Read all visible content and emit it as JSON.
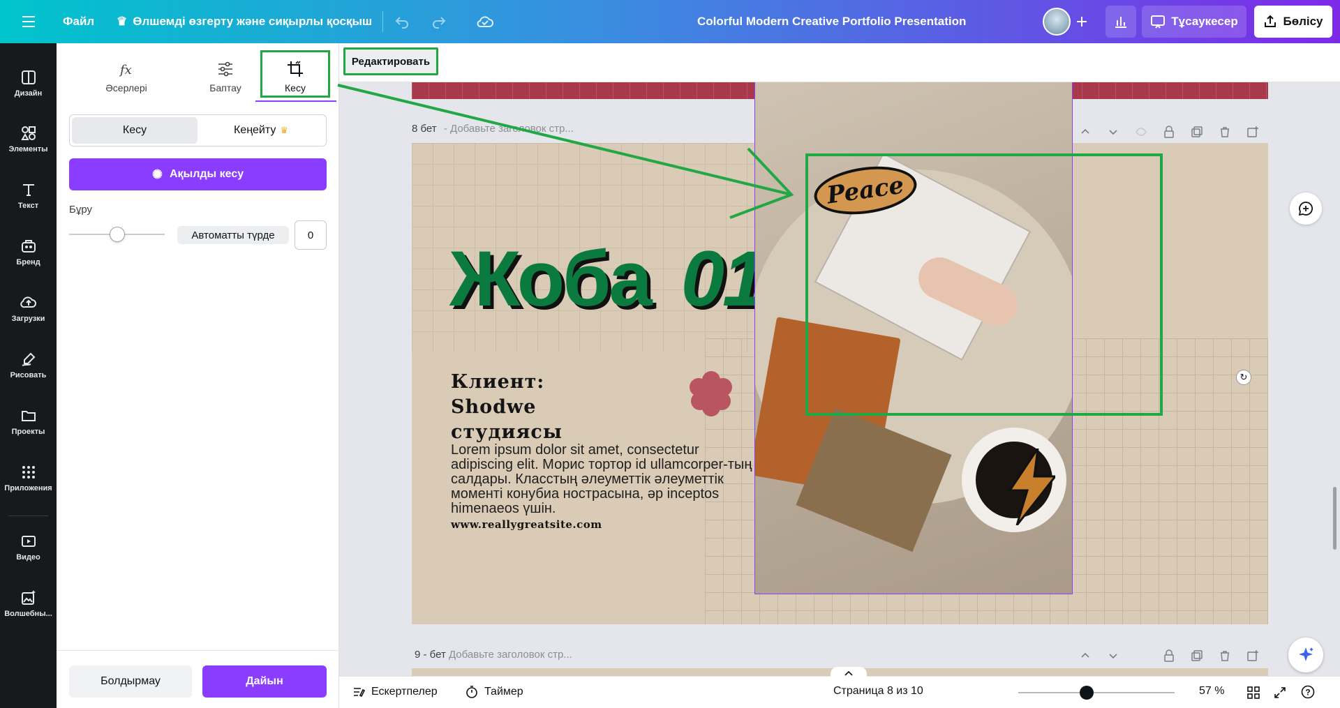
{
  "topbar": {
    "file_label": "Файл",
    "resize_label": "Өлшемді өзгерту және сиқырлы қосқыш",
    "doc_title": "Colorful Modern Creative Portfolio Presentation",
    "present_label": "Тұсаукесер",
    "share_label": "Бөлісу"
  },
  "rail": {
    "items": [
      {
        "label": "Дизайн",
        "icon": "design-icon"
      },
      {
        "label": "Элементы",
        "icon": "elements-icon"
      },
      {
        "label": "Текст",
        "icon": "text-icon"
      },
      {
        "label": "Бренд",
        "icon": "brand-icon"
      },
      {
        "label": "Загрузки",
        "icon": "upload-icon"
      },
      {
        "label": "Рисовать",
        "icon": "draw-icon"
      },
      {
        "label": "Проекты",
        "icon": "folder-icon"
      },
      {
        "label": "Приложения",
        "icon": "apps-icon"
      },
      {
        "label": "Видео",
        "icon": "video-icon"
      },
      {
        "label": "Волшебны...",
        "icon": "magic-media-icon"
      }
    ]
  },
  "panel": {
    "tabs": [
      {
        "label": "Әсерлері",
        "icon": "fx-icon"
      },
      {
        "label": "Баптау",
        "icon": "sliders-icon"
      },
      {
        "label": "Кесу",
        "icon": "crop-icon"
      }
    ],
    "seg_crop": "Кесу",
    "seg_expand": "Кеңейту",
    "smart_crop": "Ақылды кесу",
    "rotate_label": "Бұру",
    "auto_label": "Автоматты түрде",
    "rotate_value": "0",
    "rotate_slider": 0.5,
    "cancel": "Болдырмау",
    "done": "Дайын"
  },
  "context": {
    "edit_button": "Редактировать"
  },
  "pages": [
    {
      "num": "8 бет",
      "placeholder": "- Добавьте заголовок стр..."
    },
    {
      "num": "9 - бет",
      "placeholder": "Добавьте заголовок стр..."
    }
  ],
  "slide": {
    "title_word": "Жоба",
    "title_num": "01",
    "client_lines": [
      "Клиент:",
      "Shodwe",
      "студиясы"
    ],
    "body": "Lorem ipsum dolor sit amet, consectetur adipiscing elit. Морис тортор id ullamcorper-тың салдары. Класстың әлеуметтік әлеуметтік моменті конубиа нострасына, әр inceptos himenaeos үшін.",
    "url": "www.reallygreatsite.com",
    "sticker": "Peace"
  },
  "footer": {
    "notes": "Ескертпелер",
    "timer": "Таймер",
    "page_info": "Страница 8 из 10",
    "zoom": "57 %",
    "zoom_level": 0.57
  },
  "colors": {
    "accent_purple": "#8b3dff",
    "slide_bg": "#d9cbb6",
    "title_green": "#0b7a3e",
    "annotation_green": "#22a745"
  }
}
